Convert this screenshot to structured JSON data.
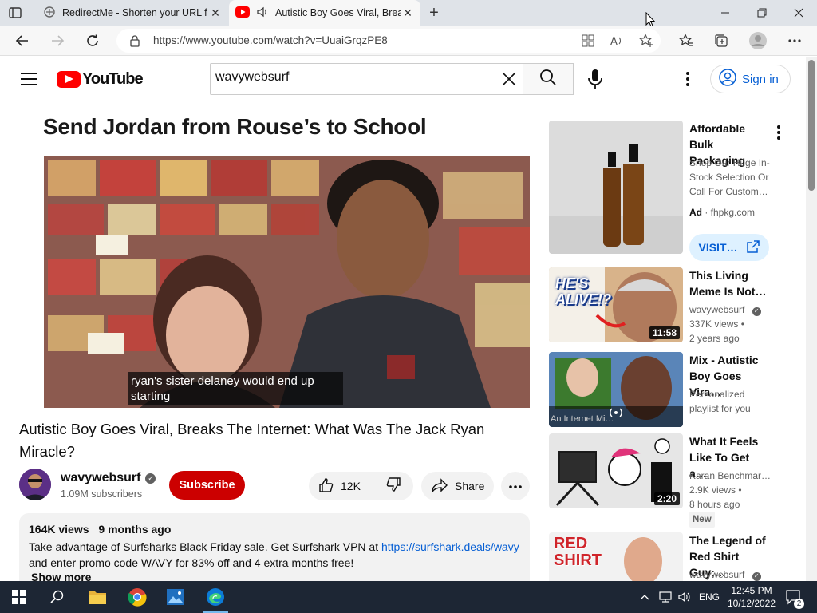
{
  "browser": {
    "tabs": [
      {
        "title": "RedirectMe - Shorten your URL f",
        "active": false
      },
      {
        "title": "Autistic Boy Goes Viral, Brea",
        "active": true
      }
    ],
    "url": "https://www.youtube.com/watch?v=UuaiGrqzPE8"
  },
  "header": {
    "logo_text": "YouTube",
    "search_value": "wavywebsurf",
    "signin_label": "Sign in"
  },
  "player": {
    "title_overlay": "Send Jordan from Rouse’s to School",
    "caption_line1": "ryan's sister delaney would end up",
    "caption_line2": "starting"
  },
  "video": {
    "title": "Autistic Boy Goes Viral, Breaks The Internet: What Was The Jack Ryan Miracle?",
    "channel": "wavywebsurf",
    "subscribers": "1.09M subscribers",
    "subscribe_label": "Subscribe",
    "likes": "12K",
    "share_label": "Share",
    "views": "164K views",
    "age": "9 months ago",
    "desc_before_link": "Take advantage of Surfsharks Black Friday sale. Get Surfshark VPN at ",
    "desc_link": "https://surfshark.deals/wavy",
    "desc_after_link": "and enter promo code WAVY for 83% off and 4 extra months free!",
    "show_more": "Show more"
  },
  "sidebar": {
    "ad": {
      "title": "Affordable Bulk Packaging",
      "body": "Shop Our Huge In-Stock Selection Or Call For Custom…",
      "ad_label": "Ad",
      "domain": "· fhpkg.com",
      "visit_label": "VISIT…"
    },
    "items": [
      {
        "title": "This Living Meme Is Not…",
        "channel": "wavywebsurf",
        "views": "337K views •",
        "age": "2 years ago",
        "duration": "11:58",
        "thumb_text": "HE'S ALIVE!?"
      },
      {
        "title": "Mix - Autistic Boy Goes Vira…",
        "channel": "Personalized playlist for you",
        "thumb_text": "An Internet Mi…"
      },
      {
        "title": "What It Feels Like To Get a…",
        "channel": "Karan Benchmar…",
        "views": "2.9K views •",
        "age": "8 hours ago",
        "duration": "2:20",
        "badge": "New"
      },
      {
        "title": "The Legend of Red Shirt Guy:…",
        "channel": "wavywebsurf",
        "thumb_text": "RED SHIRT"
      }
    ]
  },
  "taskbar": {
    "lang": "ENG",
    "time": "12:45 PM",
    "date": "10/12/2022",
    "notif_count": "2"
  },
  "colors": {
    "yt_red": "#ff0000",
    "link_blue": "#065fd4",
    "subscribe_red": "#cc0000",
    "taskbar": "#1d2634"
  }
}
